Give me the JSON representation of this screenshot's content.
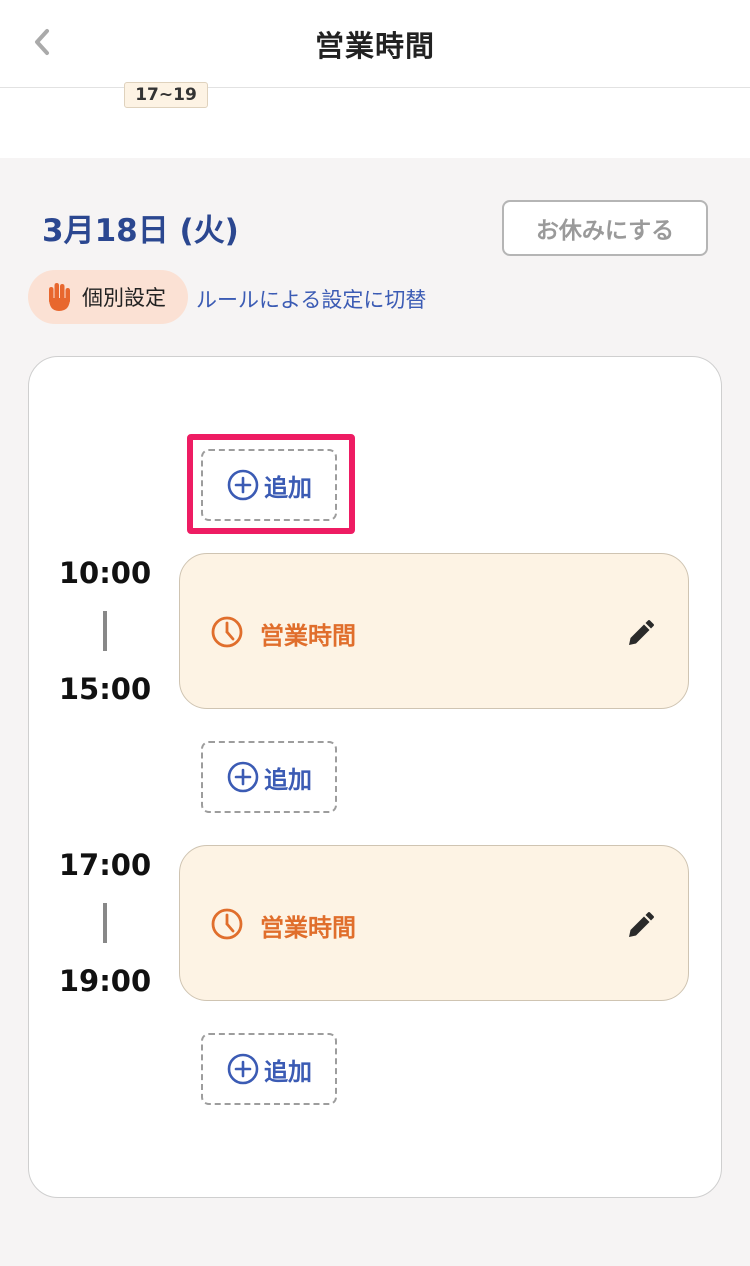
{
  "header": {
    "title": "営業時間",
    "back_icon": "chevron-left-icon"
  },
  "top_strip": {
    "partial_chip": "17~19"
  },
  "day": {
    "date": "3月18日 (火)",
    "holiday_button": "お休みにする",
    "mode_label": "個別設定",
    "mode_icon": "hand-icon",
    "switch_link": "ルールによる設定に切替"
  },
  "schedule": {
    "add_label": "追加",
    "blocks": [
      {
        "start": "10:00",
        "end": "15:00",
        "label": "営業時間"
      },
      {
        "start": "17:00",
        "end": "19:00",
        "label": "営業時間"
      }
    ]
  },
  "colors": {
    "accent_blue": "#3b5bb4",
    "date_navy": "#2b4790",
    "block_orange": "#e06e2c",
    "block_bg": "#fdf3e4",
    "highlight": "#ee1c63"
  }
}
